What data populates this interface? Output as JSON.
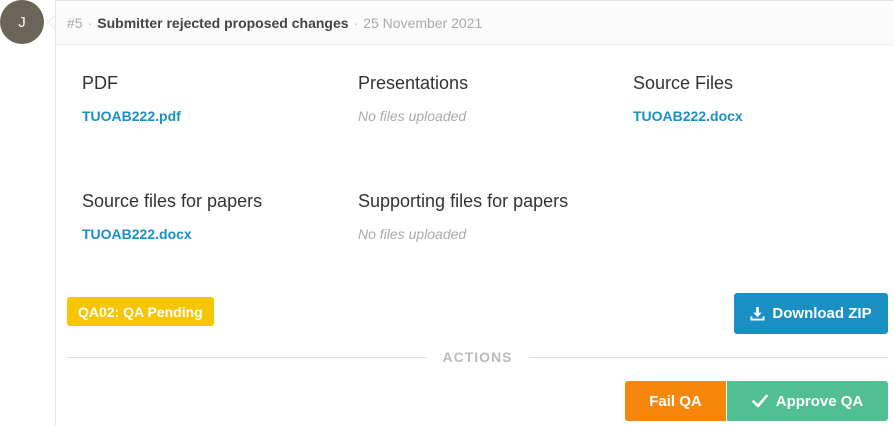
{
  "avatar": {
    "initial": "J"
  },
  "header": {
    "number": "#5",
    "separator": "·",
    "title": "Submitter rejected proposed changes",
    "date": "25 November 2021"
  },
  "files": [
    {
      "title": "PDF",
      "file": "TUOAB222.pdf",
      "empty": ""
    },
    {
      "title": "Presentations",
      "file": "",
      "empty": "No files uploaded"
    },
    {
      "title": "Source Files",
      "file": "TUOAB222.docx",
      "empty": ""
    },
    {
      "title": "Source files for papers",
      "file": "TUOAB222.docx",
      "empty": ""
    },
    {
      "title": "Supporting files for papers",
      "file": "",
      "empty": "No files uploaded"
    }
  ],
  "status_badge": "QA02: QA Pending",
  "download_button": "Download ZIP",
  "actions_label": "ACTIONS",
  "fail_button": "Fail QA",
  "approve_button": "Approve QA",
  "colors": {
    "link": "#1a8fc4",
    "badge": "#f7c600",
    "fail": "#f7860d",
    "approve": "#51bf92"
  }
}
